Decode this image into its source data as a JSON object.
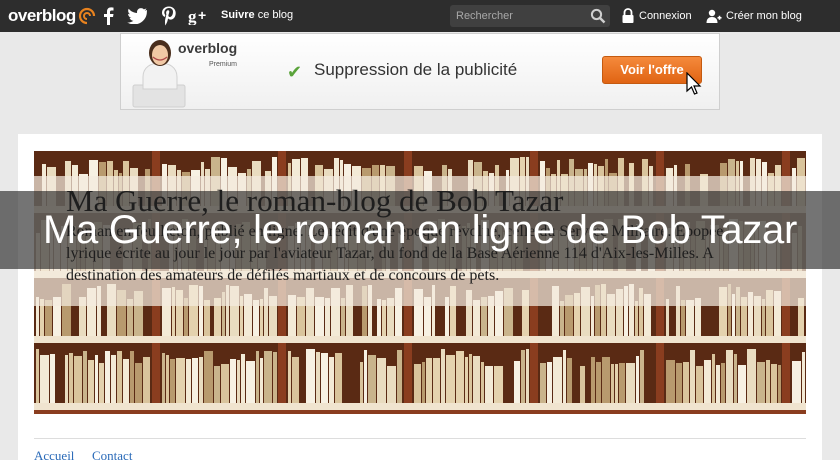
{
  "topbar": {
    "logo_text": "overblog",
    "follow_bold": "Suivre",
    "follow_rest": " ce blog",
    "search_placeholder": "Rechercher",
    "login_label": "Connexion",
    "signup_label": "Créer mon blog",
    "social": [
      "facebook-icon",
      "twitter-icon",
      "pinterest-icon",
      "google-plus-icon"
    ]
  },
  "ad": {
    "brand": "overblog",
    "tier": "Premium",
    "message": "Suppression de la publicité",
    "cta": "Voir l'offre"
  },
  "blog": {
    "header_title": "Ma Guerre, le roman-blog de Bob Tazar",
    "description": "Roman en feuilleton, publié en ligne. Le récit d'une époque révolue, celle du Service Militaire. Epopée lyrique écrite au jour le jour par l'aviateur Tazar, du fond de la Base Aérienne 114 d'Aix-les-Milles. A destination des amateurs de défilés martiaux et de concours de pets.",
    "overlay_title": "Ma Guerre, le roman en ligne de Bob Tazar"
  },
  "nav": {
    "items": [
      "Accueil",
      "Contact"
    ]
  },
  "colors": {
    "topbar": "#2d2d2d",
    "accent": "#e8821e",
    "link": "#2a6ab8"
  }
}
